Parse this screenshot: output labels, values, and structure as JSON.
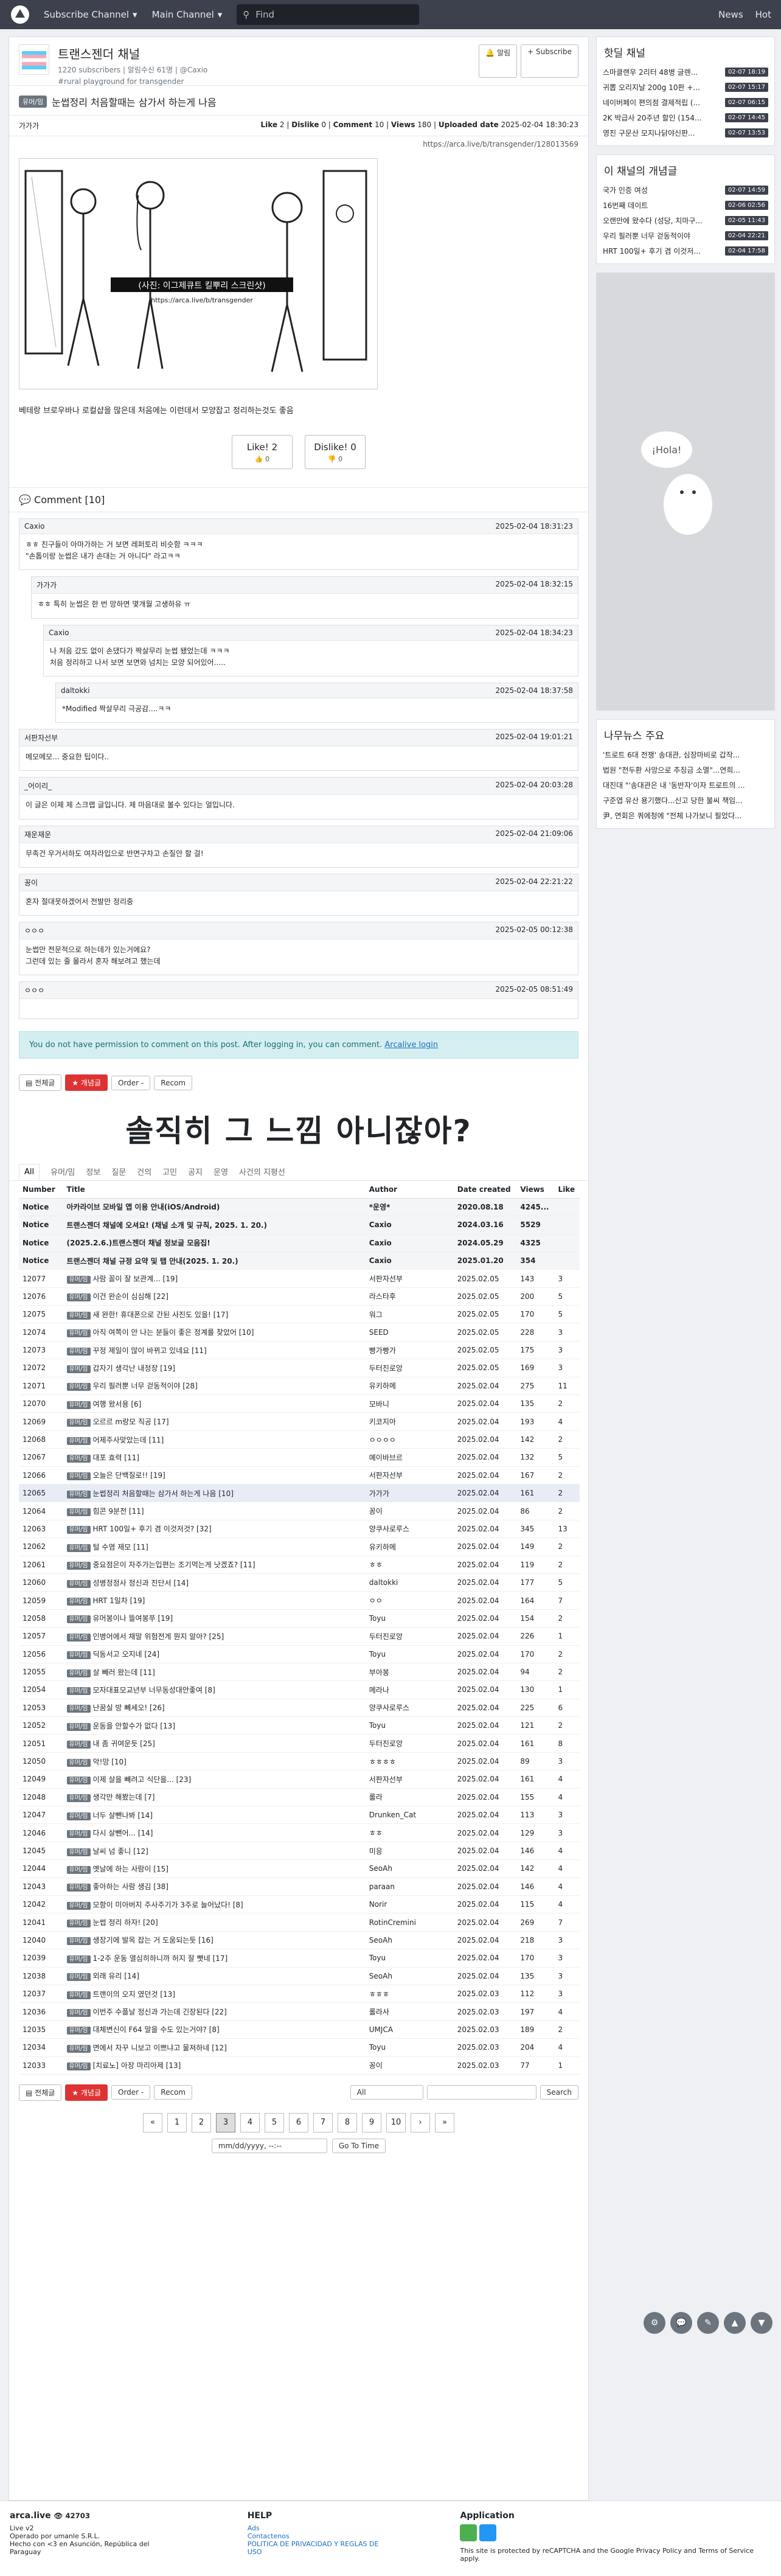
{
  "topbar": {
    "subscribe_channel": "Subscribe Channel",
    "main_channel": "Main Channel",
    "search_placeholder": "Find",
    "news": "News",
    "hot": "Hot"
  },
  "channel": {
    "name": "트랜스젠더 채널",
    "stats": "1220 subscribers | 알림수신 61명 | @Caxio",
    "description": "#rural playground for transgender",
    "alarm_label": "알림",
    "subscribe_label": "+ Subscribe"
  },
  "post": {
    "category": "유머/밈",
    "title": "눈썹정리 처음할때는 삼가서 하는게 나음",
    "author": "가가가",
    "like_label": "Like",
    "like": "2",
    "dislike_label": "Dislike",
    "dislike": "0",
    "comment_label": "Comment",
    "comment": "10",
    "views_label": "Views",
    "views": "180",
    "uploaded_label": "Uploaded date",
    "uploaded": "2025-02-04 18:30:23",
    "url": "https://arca.live/b/transgender/128013569",
    "comic_text": "(사진: 이그제큐트 킬뿌리 스크린샷)",
    "comic_caption": "https://arca.live/b/transgender",
    "body": "베테랑 브로우바나 로컬샵을 많은데 처음에는 이런데서 모양잡고 정리하는것도 좋음",
    "like_button": "Like!",
    "like_button_count": "2",
    "dislike_button": "Dislike!",
    "dislike_button_count": "0"
  },
  "comments_header": "Comment [10]",
  "comments": [
    {
      "author": "Caxio",
      "date": "2025-02-04 18:31:23",
      "body": "ㅎㅎ 친구들이 아마가하는 거 보면 레퍼토리 비슷함 ㅋㅋㅋ\n\"손톱이랑 눈썹은 내가 손대는 거 아니다\" 라고ㅋㅋ"
    },
    {
      "author": "가가가",
      "date": "2025-02-04 18:32:15",
      "body": "ㅎㅎ 특히 눈썹은 한 번 망하면 몇개월 고생하유 ㅠ"
    },
    {
      "author": "Caxio",
      "date": "2025-02-04 18:34:23",
      "body": "나 처음 갔도 없이 손댔다가 짝살무리 눈썹 됐었는데 ㅋㅋㅋ\n처음 정리하고 나서 보면 보면와 넘치는 모양 되어있어....."
    },
    {
      "author": "daltokki",
      "date": "2025-02-04 18:37:58",
      "body": "*Modified 짝살무리 극공감....ㅋㅋ"
    },
    {
      "author": "서판자선부",
      "date": "2025-02-04 19:01:21",
      "body": "메모메모... 중요한 팁이다.."
    },
    {
      "author": "_어이리_",
      "date": "2025-02-04 20:03:28",
      "body": "이 글은 이제 제 스크랩 글입니다. 제 마음대로 볼수 있다는 얼입니다."
    },
    {
      "author": "재운재운",
      "date": "2025-02-04 21:09:06",
      "body": "무족건 우거서하도 여자라입으로 반면구차고 손질안 할 걸!"
    },
    {
      "author": "꽁이",
      "date": "2025-02-04 22:21:22",
      "body": "혼자 절대못하겠어서 전발만 정리중"
    },
    {
      "author": "ㅇㅇㅇ",
      "date": "2025-02-05 00:12:38",
      "body": "눈썹만 전문적으로 하는데가 있는거에요?\n그런데 있는 줄 몰라서 혼자 해보려고 했는데"
    },
    {
      "author": "ㅇㅇㅇ",
      "date": "2025-02-05 08:51:49",
      "body": ""
    }
  ],
  "notice": {
    "text": "You do not have permission to comment on this post. After logging in, you can comment.",
    "link": "Arcalive login"
  },
  "toolbar": {
    "all_label": "전체글",
    "best_label": "개념글",
    "order_label": "Order -",
    "recom_label": "Recom"
  },
  "banner_text": "솔직히 그 느낌 아니잖아?",
  "tabs": [
    "All",
    "유머/밈",
    "정보",
    "질문",
    "건의",
    "고민",
    "공지",
    "운영",
    "사건의 지평선"
  ],
  "table_headers": [
    "Number",
    "Title",
    "Author",
    "Date created",
    "Views",
    "Like"
  ],
  "notices": [
    {
      "num": "Notice",
      "title": "아카라이브 모바일 앱 이용 안내(iOS/Android)",
      "author": "*운영*",
      "date": "2020.08.18",
      "views": "4245...",
      "like": ""
    },
    {
      "num": "Notice",
      "title": "트랜스젠더 채널에 오셔요! (채널 소개 및 규칙, 2025. 1. 20.)",
      "author": "Caxio",
      "date": "2024.03.16",
      "views": "5529",
      "like": ""
    },
    {
      "num": "Notice",
      "title": "(2025.2.6.)트랜스젠더 채널 정보글 모음집!",
      "author": "Caxio",
      "date": "2024.05.29",
      "views": "4325",
      "like": ""
    },
    {
      "num": "Notice",
      "title": "트랜스젠더 채널 규정 요약 및 탭 안내(2025. 1. 20.)",
      "author": "Caxio",
      "date": "2025.01.20",
      "views": "354",
      "like": ""
    }
  ],
  "rows": [
    {
      "num": "12077",
      "cat": "유머/밈",
      "title": "사람 꼴이 잘 보관계... [19]",
      "author": "서판자선부",
      "date": "2025.02.05",
      "views": "143",
      "like": "3"
    },
    {
      "num": "12076",
      "cat": "유머/밈",
      "title": "이건 완순이 심심해 [22]",
      "author": "라스타후",
      "date": "2025.02.05",
      "views": "200",
      "like": "5"
    },
    {
      "num": "12075",
      "cat": "유머/밈",
      "title": "새 완한! 휴대폰으로 간된 사진도 있을! [17]",
      "author": "워그",
      "date": "2025.02.05",
      "views": "170",
      "like": "5"
    },
    {
      "num": "12074",
      "cat": "유머/밈",
      "title": "아직 여쪽이 안 나는 분들이 좋은 정계를 찾았어 [10]",
      "author": "SEED",
      "date": "2025.02.05",
      "views": "228",
      "like": "3"
    },
    {
      "num": "12073",
      "cat": "유머/밈",
      "title": "꾸정 제일이 많이 바뀌고 있네요 [11]",
      "author": "빵가빵가",
      "date": "2025.02.05",
      "views": "175",
      "like": "3"
    },
    {
      "num": "12072",
      "cat": "유머/밈",
      "title": "갑자기 생각난 내정장 [19]",
      "author": "두터진로앙",
      "date": "2025.02.05",
      "views": "169",
      "like": "3"
    },
    {
      "num": "12071",
      "cat": "유머/밈",
      "title": "우리 필러뿐 너무 걷동적이야 [28]",
      "author": "유키하메",
      "date": "2025.02.04",
      "views": "275",
      "like": "11"
    },
    {
      "num": "12070",
      "cat": "유머/밈",
      "title": "여행 왔서용 [6]",
      "author": "모바니",
      "date": "2025.02.04",
      "views": "135",
      "like": "2"
    },
    {
      "num": "12069",
      "cat": "유머/밈",
      "title": "오르르 m랑모 직공 [17]",
      "author": "키코지아",
      "date": "2025.02.04",
      "views": "193",
      "like": "4"
    },
    {
      "num": "12068",
      "cat": "유머/밈",
      "title": "어제주사맞았는데 [11]",
      "author": "ㅇㅇㅇㅇ",
      "date": "2025.02.04",
      "views": "142",
      "like": "2"
    },
    {
      "num": "12067",
      "cat": "유머/밈",
      "title": "대포 효력 [11]",
      "author": "예이바브르",
      "date": "2025.02.04",
      "views": "132",
      "like": "5"
    },
    {
      "num": "12066",
      "cat": "유머/밈",
      "title": "오늘은 단백질로!! [19]",
      "author": "서판자선부",
      "date": "2025.02.04",
      "views": "167",
      "like": "2"
    },
    {
      "num": "12065",
      "cat": "유머/밈",
      "title": "눈썹정리 처음할때는 삼가서 하는게 나음 [10]",
      "author": "가가가",
      "date": "2025.02.04",
      "views": "161",
      "like": "2",
      "hl": true
    },
    {
      "num": "12064",
      "cat": "유머/밈",
      "title": "힘콘 9분전 [11]",
      "author": "꽁이",
      "date": "2025.02.04",
      "views": "86",
      "like": "2"
    },
    {
      "num": "12063",
      "cat": "유머/밈",
      "title": "HRT 100일+ 후기 겸 이것저것? [32]",
      "author": "양쿠사로루스",
      "date": "2025.02.04",
      "views": "345",
      "like": "13"
    },
    {
      "num": "12062",
      "cat": "유머/밈",
      "title": "털 수염 제모 [11]",
      "author": "유키하메",
      "date": "2025.02.04",
      "views": "149",
      "like": "2"
    },
    {
      "num": "12061",
      "cat": "유머/밈",
      "title": "중요점은이 자주가는입편는 조기먹는게 낫겠죠? [11]",
      "author": "ㅎㅎ",
      "date": "2025.02.04",
      "views": "119",
      "like": "2"
    },
    {
      "num": "12060",
      "cat": "유머/밈",
      "title": "성병정정사 정신과 진단서 [14]",
      "author": "daltokki",
      "date": "2025.02.04",
      "views": "177",
      "like": "5"
    },
    {
      "num": "12059",
      "cat": "유머/밈",
      "title": "HRT 1일차 [19]",
      "author": "ㅇㅇ",
      "date": "2025.02.04",
      "views": "164",
      "like": "7"
    },
    {
      "num": "12058",
      "cat": "유머/밈",
      "title": "유머봉이나 뜰여봉쭈 [19]",
      "author": "Toyu",
      "date": "2025.02.04",
      "views": "154",
      "like": "2"
    },
    {
      "num": "12057",
      "cat": "유머/밈",
      "title": "인병어에서 채말 위험전게 뭔지 알아? [25]",
      "author": "두터진로앙",
      "date": "2025.02.04",
      "views": "226",
      "like": "1"
    },
    {
      "num": "12056",
      "cat": "유머/밈",
      "title": "딕동서고 오지네 [24]",
      "author": "Toyu",
      "date": "2025.02.04",
      "views": "170",
      "like": "2"
    },
    {
      "num": "12055",
      "cat": "유머/밈",
      "title": "살 빼러 왔는데 [11]",
      "author": "부아봉",
      "date": "2025.02.04",
      "views": "94",
      "like": "2"
    },
    {
      "num": "12054",
      "cat": "유머/밈",
      "title": "모자대표모교년부 너무동성대안좋여 [8]",
      "author": "메라나",
      "date": "2025.02.04",
      "views": "130",
      "like": "1"
    },
    {
      "num": "12053",
      "cat": "유머/밈",
      "title": "난꿈실 방 뻬세오! [26]",
      "author": "양쿠사로루스",
      "date": "2025.02.04",
      "views": "225",
      "like": "6"
    },
    {
      "num": "12052",
      "cat": "유머/밈",
      "title": "운동을 안할수가 없다 [13]",
      "author": "Toyu",
      "date": "2025.02.04",
      "views": "121",
      "like": "2"
    },
    {
      "num": "12051",
      "cat": "유머/밈",
      "title": "내 좀 귀여운듯 [25]",
      "author": "두터진로앙",
      "date": "2025.02.04",
      "views": "161",
      "like": "8"
    },
    {
      "num": "12050",
      "cat": "유머/밈",
      "title": "악!망 [10]",
      "author": "ㅎㅎㅎㅎ",
      "date": "2025.02.04",
      "views": "89",
      "like": "3"
    },
    {
      "num": "12049",
      "cat": "유머/밈",
      "title": "이제 살을 빼려고 식단을... [23]",
      "author": "서판자선부",
      "date": "2025.02.04",
      "views": "161",
      "like": "4"
    },
    {
      "num": "12048",
      "cat": "유머/밈",
      "title": "생각만 해봤는데 [7]",
      "author": "롤라",
      "date": "2025.02.04",
      "views": "155",
      "like": "4"
    },
    {
      "num": "12047",
      "cat": "유머/밈",
      "title": "너두 살뺀나봐 [14]",
      "author": "Drunken_Cat",
      "date": "2025.02.04",
      "views": "113",
      "like": "3"
    },
    {
      "num": "12046",
      "cat": "유머/밈",
      "title": "다시 살뺀어... [14]",
      "author": "ㅎㅎ",
      "date": "2025.02.04",
      "views": "129",
      "like": "3"
    },
    {
      "num": "12045",
      "cat": "유머/밈",
      "title": "날씨 넘 좋니 [12]",
      "author": "미응",
      "date": "2025.02.04",
      "views": "146",
      "like": "4"
    },
    {
      "num": "12044",
      "cat": "유머/밈",
      "title": "옛날에 하는 사람이 [15]",
      "author": "SeoAh",
      "date": "2025.02.04",
      "views": "142",
      "like": "4"
    },
    {
      "num": "12043",
      "cat": "유머/밈",
      "title": "좋아하는 사람 생김 [38]",
      "author": "paraan",
      "date": "2025.02.04",
      "views": "146",
      "like": "4"
    },
    {
      "num": "12042",
      "cat": "유머/밈",
      "title": "모항이 미아버지 주사주기가 3주로 늘어났다! [8]",
      "author": "Norir",
      "date": "2025.02.04",
      "views": "115",
      "like": "4"
    },
    {
      "num": "12041",
      "cat": "유머/밈",
      "title": "눈썹 정리 하자! [20]",
      "author": "RotinCremini",
      "date": "2025.02.04",
      "views": "269",
      "like": "7"
    },
    {
      "num": "12040",
      "cat": "유머/밈",
      "title": "생장기에 발목 잡는 거 도움되는듯 [16]",
      "author": "SeoAh",
      "date": "2025.02.04",
      "views": "218",
      "like": "3"
    },
    {
      "num": "12039",
      "cat": "유머/밈",
      "title": "1-2주 운동 열심히하니까 허지 잘 빳네 [17]",
      "author": "Toyu",
      "date": "2025.02.04",
      "views": "170",
      "like": "3"
    },
    {
      "num": "12038",
      "cat": "유머/밈",
      "title": "외래 유리 [14]",
      "author": "SeoAh",
      "date": "2025.02.04",
      "views": "135",
      "like": "3"
    },
    {
      "num": "12037",
      "cat": "유머/밈",
      "title": "트랜이의 오지 였던것 [13]",
      "author": "ㅎㅎㅎ",
      "date": "2025.02.03",
      "views": "112",
      "like": "3"
    },
    {
      "num": "12036",
      "cat": "유머/밈",
      "title": "이번주 수플날 정신과 가는데 긴장된다 [22]",
      "author": "롤라사",
      "date": "2025.02.03",
      "views": "197",
      "like": "4"
    },
    {
      "num": "12035",
      "cat": "유머/밈",
      "title": "대체변신이 F64 말을 수도 있는거야? [8]",
      "author": "UMJCA",
      "date": "2025.02.03",
      "views": "189",
      "like": "2"
    },
    {
      "num": "12034",
      "cat": "유머/밈",
      "title": "면에서 자꾸 니보고 이쁘냐고 물져하네 [12]",
      "author": "Toyu",
      "date": "2025.02.03",
      "views": "204",
      "like": "4"
    },
    {
      "num": "12033",
      "cat": "유머/밈",
      "title": "[치료노] 아장 마리아제 [13]",
      "author": "꽁이",
      "date": "2025.02.03",
      "views": "77",
      "like": "1"
    }
  ],
  "pager": [
    "1",
    "2",
    "3",
    "4",
    "5",
    "6",
    "7",
    "8",
    "9",
    "10"
  ],
  "current_page": "3",
  "search_bottom": {
    "select": "All",
    "button": "Search",
    "date_placeholder": "mm/dd/yyyy, --:--",
    "goto": "Go To Time"
  },
  "aside": {
    "hot_title": "핫딜 채널",
    "hot_items": [
      {
        "t": "스마클랜우 2리터 48병 글렌...",
        "d": "02-07 18:19"
      },
      {
        "t": "귀뽑 오리지날 200g 10판 +...",
        "d": "02-07 15:17"
      },
      {
        "t": "네이버페이 편의점 결제적립 (...",
        "d": "02-07 06:15"
      },
      {
        "t": "2K 박급사 20주년 할인 (154...",
        "d": "02-07 14:45"
      },
      {
        "t": "영진 구문산 모지나닭야신판...",
        "d": "02-07 13:53"
      }
    ],
    "concept_title": "이 채널의 개념글",
    "concept_items": [
      {
        "t": "국가 인증 여성",
        "d": "02-07 14:59"
      },
      {
        "t": "16번째 데이트",
        "d": "02-06 02:56"
      },
      {
        "t": "오랜만에 왔수다 (성당, 치마구...",
        "d": "02-05 11:43"
      },
      {
        "t": "우리 필러뿐 너무 걷동적이야",
        "d": "02-04 22:21"
      },
      {
        "t": "HRT 100일+ 후기 겸 이것저...",
        "d": "02-04 17:58"
      }
    ],
    "ad_text": "¡Hola!",
    "news_title": "나무뉴스 주요",
    "news_items": [
      "'트로트 6대 전쟁' 송대관, 심장마비로 갑작...",
      "법원 \"전두환 사망으로 추징금 소멸\"...연희...",
      "대진대 \"'송대관은 내 '동반자'이자 트로트의 ...",
      "구준엽 유산 용기했다...신고 당한 불씨 책임...",
      "尹, 연회은 쿼에청에 \"전체 나가보니 필었다..."
    ]
  },
  "footer": {
    "brand": "arca.live",
    "visitors": "👁 42703",
    "version": "Live v2",
    "operator": "Operado por umanle S.R.L.",
    "made": "Hecho con <3 en Asunción, República del Paraguay",
    "help_title": "HELP",
    "help_links": [
      "Ads",
      "Contactenos",
      "POLITICA DE PRIVACIDAD Y REGLAS DE USO"
    ],
    "app_title": "Application",
    "recaptcha": "This site is protected by reCAPTCHA and the Google Privacy Policy and Terms of Service apply."
  }
}
